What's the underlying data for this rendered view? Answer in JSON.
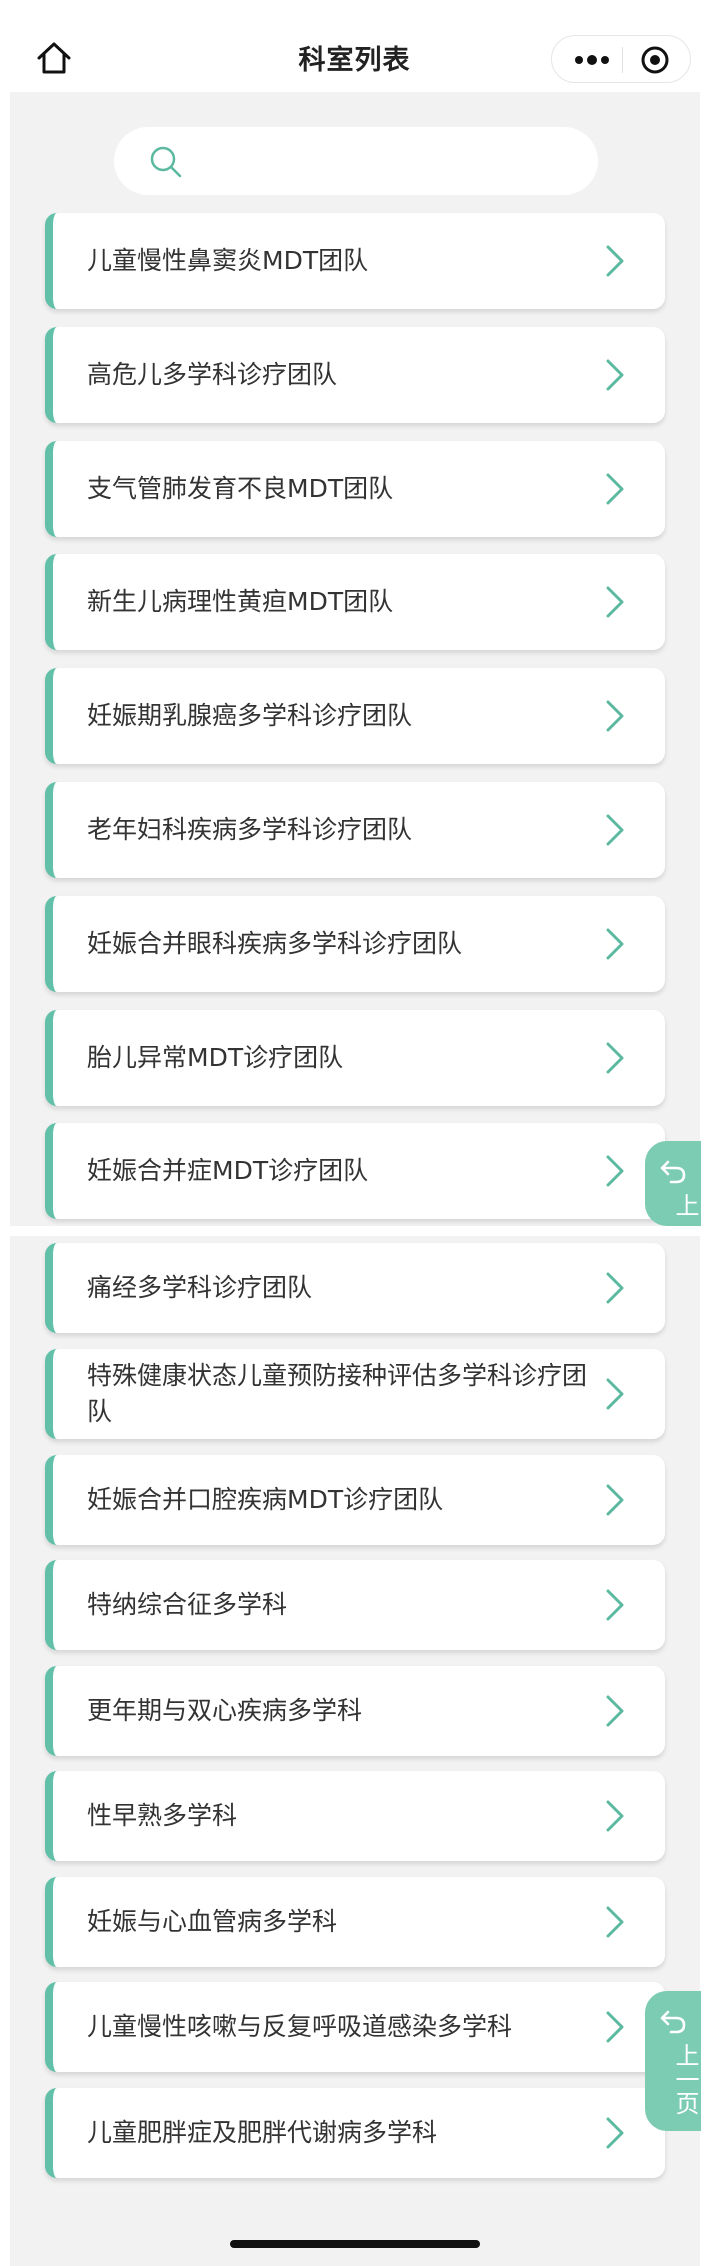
{
  "nav": {
    "title": "科室列表"
  },
  "search": {
    "placeholder": ""
  },
  "list_top": [
    "儿童慢性鼻窦炎MDT团队",
    "高危儿多学科诊疗团队",
    "支气管肺发育不良MDT团队",
    "新生儿病理性黄疸MDT团队",
    "妊娠期乳腺癌多学科诊疗团队",
    "老年妇科疾病多学科诊疗团队",
    "妊娠合并眼科疾病多学科诊疗团队",
    "胎儿异常MDT诊疗团队",
    "妊娠合并症MDT诊疗团队"
  ],
  "list_bottom": [
    "痛经多学科诊疗团队",
    "特殊健康状态儿童预防接种评估多学科诊疗团队",
    "妊娠合并口腔疾病MDT诊疗团队",
    "特纳综合征多学科",
    "更年期与双心疾病多学科",
    "性早熟多学科",
    "妊娠与心血管病多学科",
    "儿童慢性咳嗽与反复呼吸道感染多学科",
    "儿童肥胖症及肥胖代谢病多学科"
  ],
  "page_button_1": {
    "label": "上"
  },
  "page_button_2": {
    "label": "上一页"
  },
  "colors": {
    "accent": "#63c0a8",
    "page_button": "#7ccbb3",
    "panel_bg": "#f2f2f2"
  }
}
